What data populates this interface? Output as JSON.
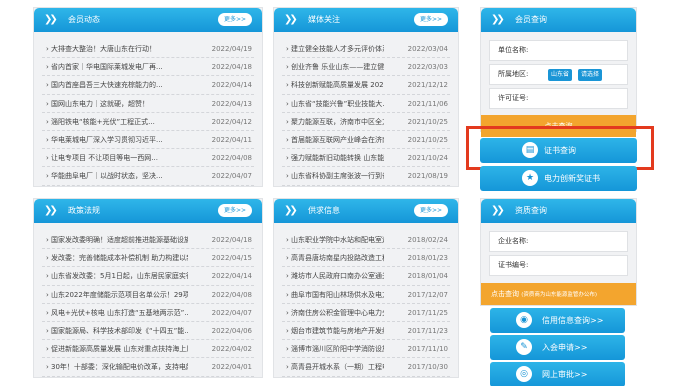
{
  "member_news": {
    "title": "会员动态",
    "more": "更多>>",
    "items": [
      {
        "title": "大排查大整治！大唐山东在行动！",
        "date": "2022/04/19"
      },
      {
        "title": "省内首家｜华电国际莱城发电厂再...",
        "date": "2022/04/18"
      },
      {
        "title": "国内首座昌吾三大快速充棕能力的...",
        "date": "2022/04/14"
      },
      {
        "title": "国网山东电力｜这就硬，超赞！",
        "date": "2022/04/13"
      },
      {
        "title": "淄阳铁电“核能+光伏”工程正式...",
        "date": "2022/04/12"
      },
      {
        "title": "华电莱城电厂深入学习贯彻习近平...",
        "date": "2022/04/11"
      },
      {
        "title": "让电专项目 不让项目等电一西网...",
        "date": "2022/04/08"
      },
      {
        "title": "华能曲阜电厂｜以战时状态，坚决...",
        "date": "2022/04/07"
      }
    ]
  },
  "media_news": {
    "title": "媒体关注",
    "more": "更多>>",
    "items": [
      {
        "title": "建立健全技能人才多元评价体系...",
        "date": "2022/03/04"
      },
      {
        "title": "创业齐鲁 乐业山东——建立健全...",
        "date": "2022/03/03"
      },
      {
        "title": "科技创新赋能高质量发展 2021年...",
        "date": "2021/12/12"
      },
      {
        "title": "山东省“技能兴鲁”职业技能大...",
        "date": "2021/11/06"
      },
      {
        "title": "聚力能源互联，济南市中区全力...",
        "date": "2021/10/25"
      },
      {
        "title": "首届能源互联网产业峰会在济南...",
        "date": "2021/10/25"
      },
      {
        "title": "强力赋能新旧动能转换 山东能源...",
        "date": "2021/10/24"
      },
      {
        "title": "山东省科协副主席张波一行到省...",
        "date": "2021/08/19"
      }
    ]
  },
  "member_query": {
    "title": "会员查询",
    "unit_label": "单位名称:",
    "region_label": "所属地区:",
    "region_value": "山东省",
    "region_button": "请选择",
    "license_label": "许可证号:",
    "search_button": "点击查询",
    "cert_query": "证书查询",
    "innovation_cert": "电力创新奖证书"
  },
  "policy": {
    "title": "政策法规",
    "more": "更多>>",
    "items": [
      {
        "title": "国家发改委明确！适度超前推进能源基础设施...",
        "date": "2022/04/18"
      },
      {
        "title": "发改委：完善储能成本补偿机制 助力构建以新...",
        "date": "2022/04/15"
      },
      {
        "title": "山东省发改委：5月1日起，山东居民家庭实行...",
        "date": "2022/04/14"
      },
      {
        "title": "山东2022年度储能示范项目名单公示！29项目...",
        "date": "2022/04/08"
      },
      {
        "title": "风电+光伏+核电 山东打造“五基地两示范”...",
        "date": "2022/04/07"
      },
      {
        "title": "国家能源局、科学技术部印发《“十四五”能...",
        "date": "2022/04/06"
      },
      {
        "title": "促进新能源高质量发展 山东对重点扶持海上风...",
        "date": "2022/04/02"
      },
      {
        "title": "30年！十部委：深化输配电价改革，支持电能...",
        "date": "2022/04/01"
      }
    ]
  },
  "supply": {
    "title": "供求信息",
    "more": "更多>>",
    "items": [
      {
        "title": "山东职业学院中水站和配电室运行...",
        "date": "2018/02/24"
      },
      {
        "title": "高青县唐坊南星内投路改造工程...",
        "date": "2018/01/23"
      },
      {
        "title": "潍坊市人民政府口南办公室通关中...",
        "date": "2018/01/04"
      },
      {
        "title": "曲阜市国有阳山林场供水及电力维...",
        "date": "2017/12/07"
      },
      {
        "title": "济南住房公积金管理中心电力分中...",
        "date": "2017/11/25"
      },
      {
        "title": "烟台市建筑节能与房地产开发综合...",
        "date": "2017/11/23"
      },
      {
        "title": "淄博市淄川区阶阳中学消防设施检...",
        "date": "2017/11/10"
      },
      {
        "title": "高青县开城水系（一期）工程电力...",
        "date": "2017/10/30"
      }
    ]
  },
  "qualification": {
    "title": "资质查询",
    "company_label": "企业名称:",
    "cert_no_label": "证书编号:",
    "search_button": "点击查询",
    "search_note": "(资质商为山东能源监管办公布)",
    "credit_query": "信用信息查询>>",
    "join_apply": "入会申请>>",
    "online_approval": "网上审批>>"
  },
  "colors": {
    "header_blue": "#1a9ad9",
    "orange": "#f3a52e",
    "highlight_red": "#e33a1e"
  }
}
